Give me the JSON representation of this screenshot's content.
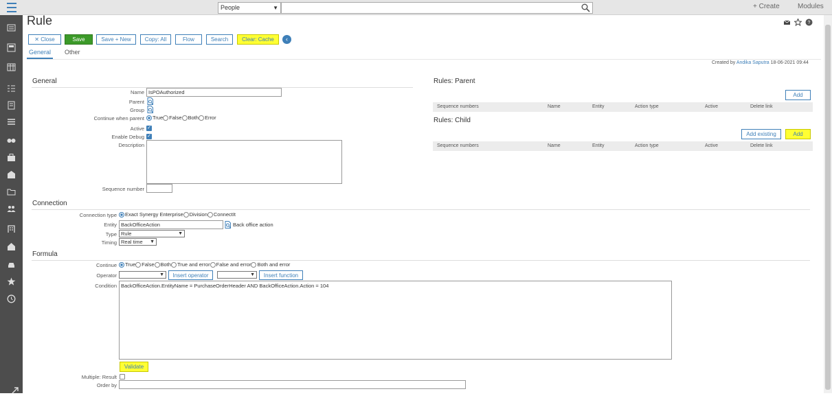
{
  "sidebar": {
    "icons": [
      "menu-icon",
      "dashboard-icon",
      "calendar-icon",
      "grid-icon",
      "tasks-icon",
      "documents-icon",
      "list-icon",
      "binoculars-icon",
      "briefcase-icon",
      "mail-icon",
      "folder-icon",
      "people-icon",
      "building-icon",
      "home-icon",
      "car-icon",
      "star-icon",
      "history-icon",
      "expand-icon"
    ]
  },
  "topbar": {
    "search_scope": "People",
    "search_value": "",
    "create_label": "+ Create",
    "modules_label": "Modules"
  },
  "page": {
    "title": "Rule",
    "created_by_prefix": "Created by",
    "created_by_user": "Andika Saputra",
    "created_date": "18-06-2021 09:44"
  },
  "toolbar": {
    "close": "✕ Close",
    "save": "Save",
    "save_new": "Save + New",
    "copy_all": "Copy: All",
    "flow": "Flow",
    "search": "Search",
    "clear_cache": "Clear: Cache"
  },
  "tabs": [
    "General",
    "Other"
  ],
  "general": {
    "heading": "General",
    "name_label": "Name",
    "name_value": "IsPOAuthorized",
    "parent_label": "Parent",
    "group_label": "Group",
    "continue_label": "Continue when parent",
    "continue_options": [
      "True",
      "False",
      "Both",
      "Error"
    ],
    "active_label": "Active",
    "debug_label": "Enable Debug",
    "description_label": "Description",
    "sequence_label": "Sequence number"
  },
  "rules_parent": {
    "heading": "Rules: Parent",
    "add": "Add",
    "columns": [
      "Sequence numbers",
      "Name",
      "Entity",
      "Action type",
      "Active",
      "Delete link"
    ]
  },
  "rules_child": {
    "heading": "Rules: Child",
    "add_existing": "Add existing",
    "add": "Add",
    "columns": [
      "Sequence numbers",
      "Name",
      "Entity",
      "Action type",
      "Active",
      "Delete link"
    ]
  },
  "connection": {
    "heading": "Connection",
    "type_label": "Connection type",
    "type_options": [
      "Exact Synergy Enterprise",
      "Division",
      "ConnectIt"
    ],
    "entity_label": "Entity",
    "entity_value": "BackOfficeAction",
    "entity_desc": "Back office action",
    "rtype_label": "Type",
    "rtype_value": "Rule",
    "timing_label": "Timing",
    "timing_value": "Real time"
  },
  "formula": {
    "heading": "Formula",
    "continue_label": "Continue",
    "continue_options": [
      "True",
      "False",
      "Both",
      "True and error",
      "False and error",
      "Both and error"
    ],
    "operator_label": "Operator",
    "insert_operator": "Insert operator",
    "insert_function": "Insert function",
    "condition_label": "Condition",
    "condition_value": "BackOfficeAction.EntityName = PurchaseOrderHeader AND BackOfficeAction.Action = 104",
    "validate": "Validate",
    "multiple_label": "Multiple: Result",
    "orderby_label": "Order by"
  },
  "colors": {
    "accent": "#3e7fb8",
    "save": "#3c9a29",
    "highlight": "#ffff33",
    "sidebar": "#4d4d4d"
  }
}
